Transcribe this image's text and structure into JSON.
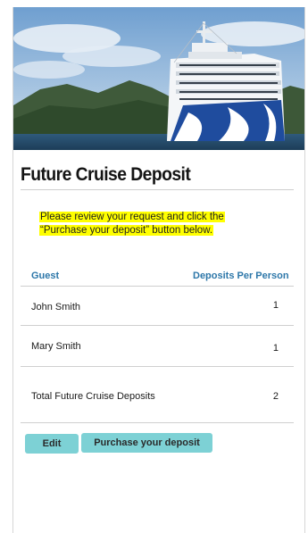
{
  "page": {
    "title": "Future Cruise Deposit",
    "notice": "Please review your request and click the “Purchase your deposit” button below."
  },
  "table": {
    "headers": {
      "guest": "Guest",
      "deposits": "Deposits Per Person"
    },
    "rows": [
      {
        "guest": "John Smith",
        "deposits": "1"
      },
      {
        "guest": "Mary Smith",
        "deposits": "1"
      }
    ],
    "total": {
      "label": "Total Future Cruise Deposits",
      "value": "2"
    }
  },
  "actions": {
    "edit_label": "Edit",
    "purchase_label": "Purchase your deposit"
  },
  "colors": {
    "highlight": "#ffff00",
    "header_blue": "#2d77a9",
    "button_teal": "#7dd1d5"
  }
}
